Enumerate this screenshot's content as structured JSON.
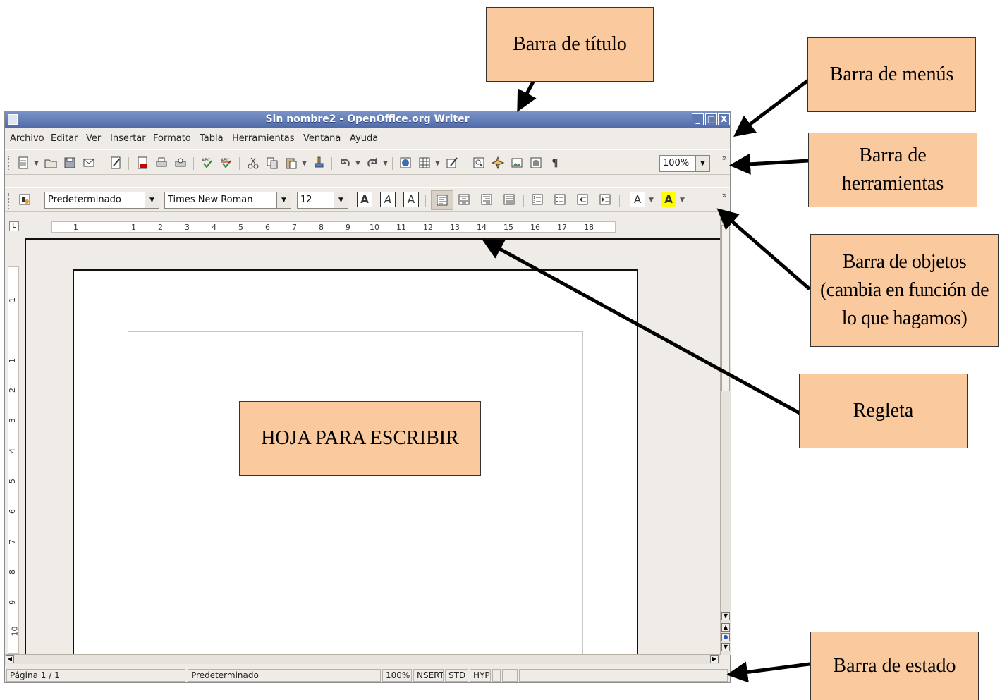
{
  "window": {
    "title": "Sin nombre2 - OpenOffice.org Writer",
    "minimize_glyph": "_",
    "maximize_glyph": "□",
    "close_glyph": "X"
  },
  "menubar": {
    "items": [
      "Archivo",
      "Editar",
      "Ver",
      "Insertar",
      "Formato",
      "Tabla",
      "Herramientas",
      "Ventana",
      "Ayuda"
    ]
  },
  "toolbar": {
    "icons": [
      "new-document-icon",
      "open-folder-icon",
      "save-icon",
      "email-icon",
      "edit-file-icon",
      "export-pdf-icon",
      "print-icon",
      "print-preview-icon",
      "spellcheck-icon",
      "autospellcheck-icon",
      "cut-icon",
      "copy-icon",
      "paste-icon",
      "format-paintbrush-icon",
      "undo-icon",
      "redo-icon",
      "hyperlink-icon",
      "table-icon",
      "draw-icon",
      "find-replace-icon",
      "navigator-icon",
      "gallery-icon",
      "data-sources-icon",
      "pilcrow-icon"
    ],
    "zoom_value": "100%",
    "pilcrow_glyph": "¶",
    "overflow_glyph": "»"
  },
  "formatting": {
    "style_value": "Predeterminado",
    "font_value": "Times New Roman",
    "size_value": "12",
    "bold_glyph": "A",
    "italic_glyph": "A",
    "underline_glyph": "A",
    "font_color_glyph": "A",
    "highlight_glyph": "A",
    "highlight_color": "#ffff00",
    "font_color_accent": "#cc0000"
  },
  "ruler": {
    "corner_glyph": "L",
    "h_ticks": [
      "1",
      "1",
      "2",
      "3",
      "4",
      "5",
      "6",
      "7",
      "8",
      "9",
      "10",
      "11",
      "12",
      "13",
      "14",
      "15",
      "16",
      "17",
      "18"
    ],
    "v_ticks": [
      "1",
      "1",
      "2",
      "3",
      "4",
      "5",
      "6",
      "7",
      "8",
      "9",
      "10"
    ]
  },
  "status": {
    "page": "Página  1 / 1",
    "style": "Predeterminado",
    "zoom": "100%",
    "insert": "NSERT",
    "selection": "STD",
    "hyphen": "HYP"
  },
  "annotations": {
    "title_bar": "Barra de título",
    "menu_bar": "Barra de menús",
    "toolbar_line1": "Barra de",
    "toolbar_line2": "herramientas",
    "objects_line1": "Barra de objetos",
    "objects_line2": "(cambia en función de",
    "objects_line3": "lo que hagamos)",
    "ruler": "Regleta",
    "page": "HOJA PARA ESCRIBIR",
    "status_bar": "Barra de estado",
    "color": "#fac99e"
  }
}
